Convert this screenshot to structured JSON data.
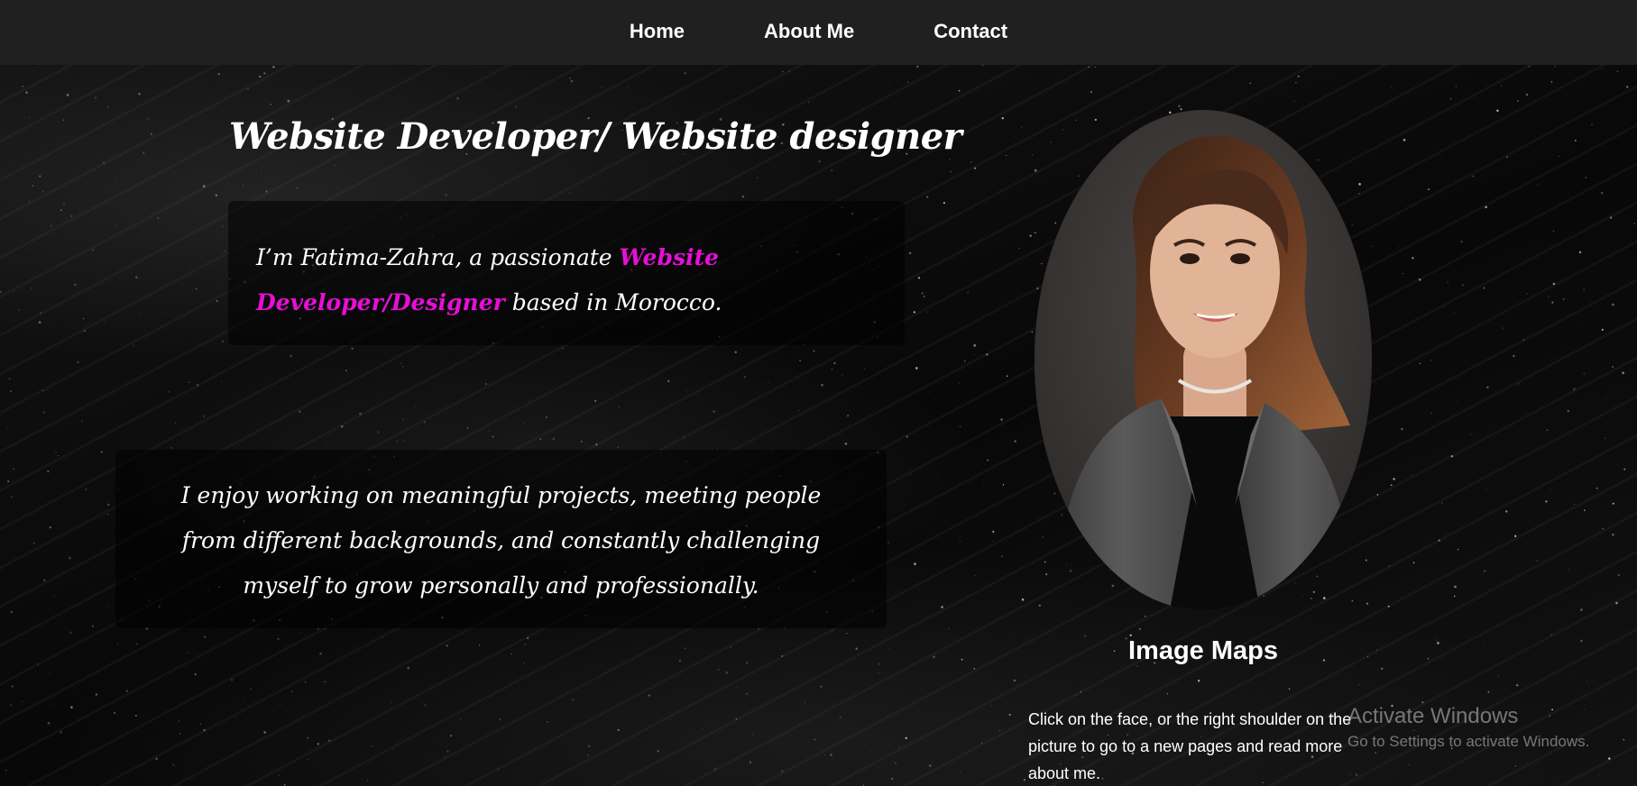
{
  "nav": {
    "items": [
      {
        "label": "Home"
      },
      {
        "label": "About Me"
      },
      {
        "label": "Contact"
      }
    ]
  },
  "hero": {
    "headline": "Website Developer/ Website designer",
    "intro_prefix": "I’m Fatima-Zahra, a passionate ",
    "intro_highlight": "Website Developer/Designer",
    "intro_suffix": " based in Morocco."
  },
  "about": {
    "text": "I enjoy working on meaningful projects, meeting people from different backgrounds, and constantly challenging myself to grow personally and professionally."
  },
  "image_maps": {
    "title": "Image Maps",
    "description": "Click on the face, or the right shoulder on the picture to go to a new pages and read more about me."
  },
  "watermark": {
    "title": "Activate Windows",
    "subtitle": "Go to Settings to activate Windows."
  },
  "colors": {
    "accent": "#e60fd6",
    "navbar": "#202020"
  }
}
